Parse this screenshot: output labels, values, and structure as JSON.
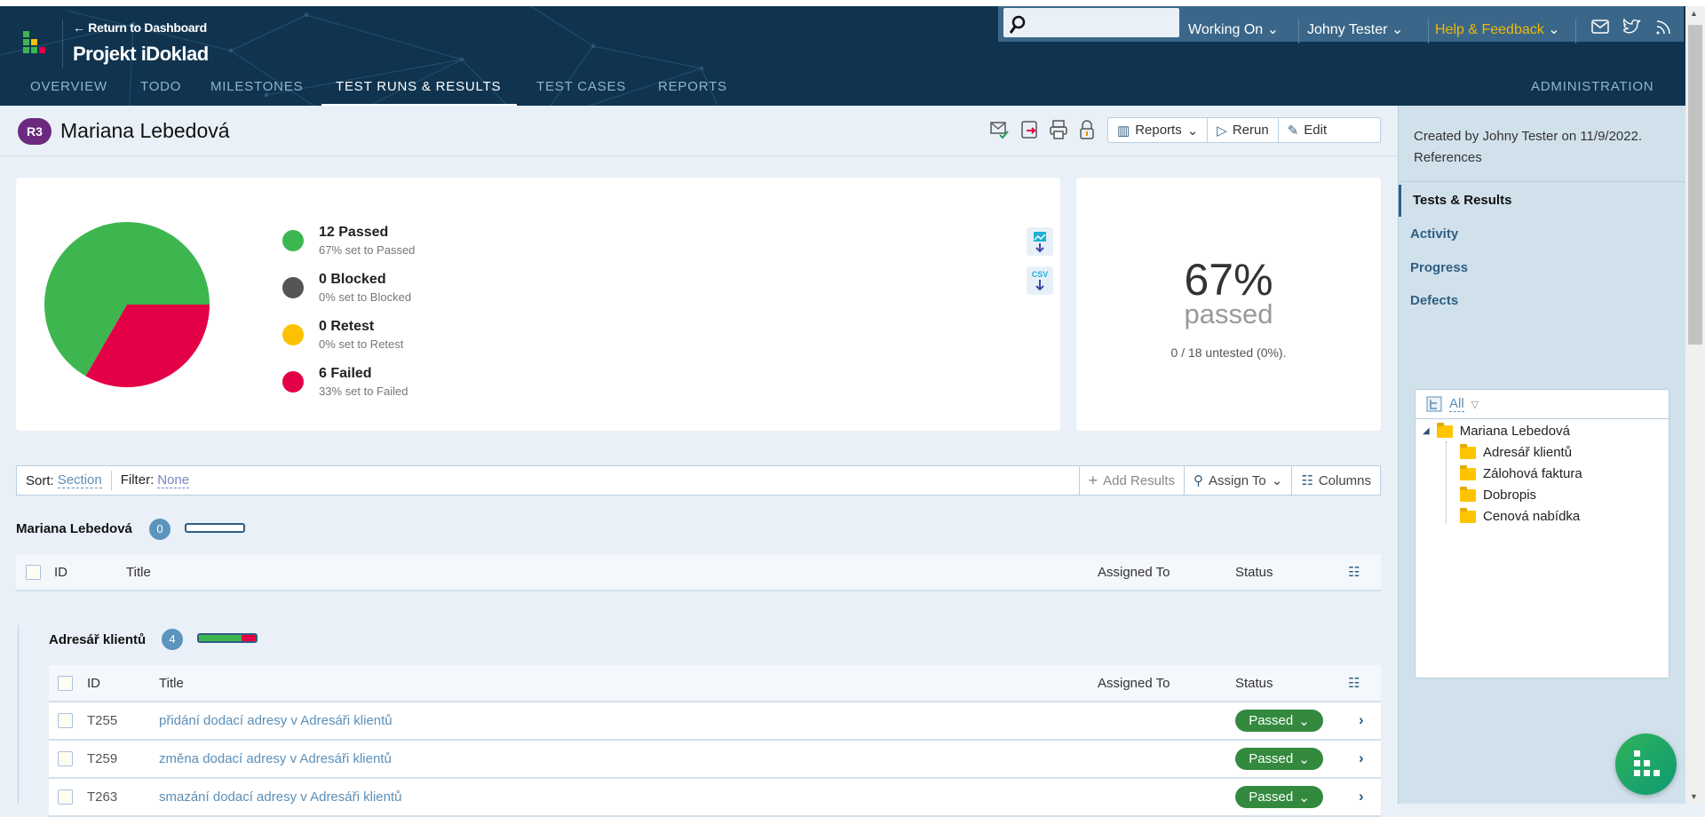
{
  "header": {
    "return_link": "← Return to Dashboard",
    "project": "Projekt iDoklad",
    "tabs": [
      "OVERVIEW",
      "TODO",
      "MILESTONES",
      "TEST RUNS & RESULTS",
      "TEST CASES",
      "REPORTS"
    ],
    "active_tab": "TEST RUNS & RESULTS",
    "admin": "ADMINISTRATION",
    "search_placeholder": "",
    "working_on": "Working On",
    "user": "Johny Tester",
    "help": "Help & Feedback"
  },
  "run": {
    "badge": "R3",
    "title": "Mariana Lebedová",
    "buttons": {
      "reports": "Reports",
      "rerun": "Rerun",
      "edit": "Edit"
    }
  },
  "chart_data": {
    "type": "pie",
    "categories": [
      "Passed",
      "Blocked",
      "Retest",
      "Failed"
    ],
    "values": [
      12,
      0,
      0,
      6
    ],
    "colors": [
      "#3db650",
      "#555555",
      "#fcc200",
      "#e40046"
    ]
  },
  "legend": [
    {
      "label": "12 Passed",
      "sub": "67% set to Passed"
    },
    {
      "label": "0 Blocked",
      "sub": "0% set to Blocked"
    },
    {
      "label": "0 Retest",
      "sub": "0% set to Retest"
    },
    {
      "label": "6 Failed",
      "sub": "33% set to Failed"
    }
  ],
  "export": {
    "csv": "CSV"
  },
  "stats": {
    "percent": "67%",
    "label": "passed",
    "untested": "0 / 18 untested (0%)."
  },
  "sidebar": {
    "created": "Created by Johny Tester on 11/9/2022.",
    "references": "References",
    "nav": [
      "Tests & Results",
      "Activity",
      "Progress",
      "Defects"
    ],
    "tree_filter": "All",
    "tree_root": "Mariana Lebedová",
    "tree_children": [
      "Adresář klientů",
      "Zálohová faktura",
      "Dobropis",
      "Cenová nabídka"
    ]
  },
  "filterbar": {
    "sort_label": "Sort:",
    "sort_value": "Section",
    "filter_label": "Filter:",
    "filter_value": "None",
    "add_results": "Add Results",
    "assign_to": "Assign To",
    "columns": "Columns"
  },
  "sections": [
    {
      "name": "Mariana Lebedová",
      "count": "0",
      "progress": {
        "passed": 0,
        "failed": 0
      }
    },
    {
      "name": "Adresář klientů",
      "count": "4",
      "progress": {
        "passed": 0.75,
        "failed": 0.25
      }
    }
  ],
  "table": {
    "headers": {
      "id": "ID",
      "title": "Title",
      "assigned": "Assigned To",
      "status": "Status"
    },
    "rows": [
      {
        "id": "T255",
        "title": "přidání dodací adresy v Adresáři klientů",
        "status": "Passed"
      },
      {
        "id": "T259",
        "title": "změna dodací adresy v Adresáři klientů",
        "status": "Passed"
      },
      {
        "id": "T263",
        "title": "smazání dodací adresy v Adresáři klientů",
        "status": "Passed"
      }
    ]
  },
  "colors": {
    "header": "#10344f",
    "accent": "#2f5e82",
    "passed": "#338a3e",
    "failed": "#e40046",
    "help": "#f2b705"
  }
}
